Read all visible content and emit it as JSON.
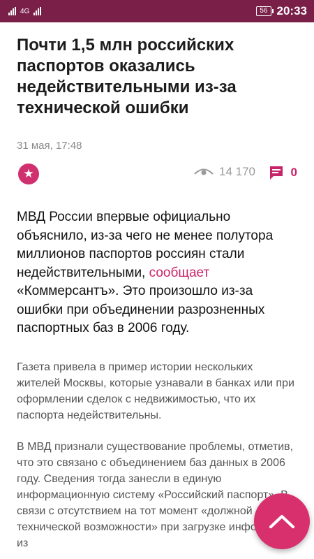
{
  "status_bar": {
    "network": "4G",
    "battery": "56",
    "time": "20:33"
  },
  "article": {
    "title": "Почти 1,5 млн российских паспортов оказались недействительными из-за технической ошибки",
    "date": "31 мая, 17:48",
    "views": "14 170",
    "comments": "0",
    "lead_before_link": "МВД России впервые официально объяснило, из-за чего не менее полутора миллионов паспортов россиян стали недействительными, ",
    "lead_link": "сообщает",
    "lead_after_link": " «Коммерсантъ». Это произошло из-за ошибки при объединении разрозненных паспортных баз в 2006 году.",
    "paragraphs": [
      "Газета привела в пример истории нескольких жителей Москвы, которые узнавали в банках или при оформлении сделок с недвижимостью, что их паспорта недействительны.",
      "В МВД признали существование проблемы, отметив, что это связано с объединением баз данных в 2006 году. Сведения тогда занесли в единую информационную систему «Российский паспорт». В связи с отсутствием на тот момент «должной технической возможности» при загрузке информации из"
    ]
  },
  "icons": {
    "favorite": "star-icon",
    "views": "eye-icon",
    "comments": "comment-icon",
    "scroll_top": "chevron-up-icon"
  },
  "colors": {
    "status_bar": "#7a1f48",
    "accent": "#d0306e",
    "muted_text": "#8a8a8a"
  }
}
